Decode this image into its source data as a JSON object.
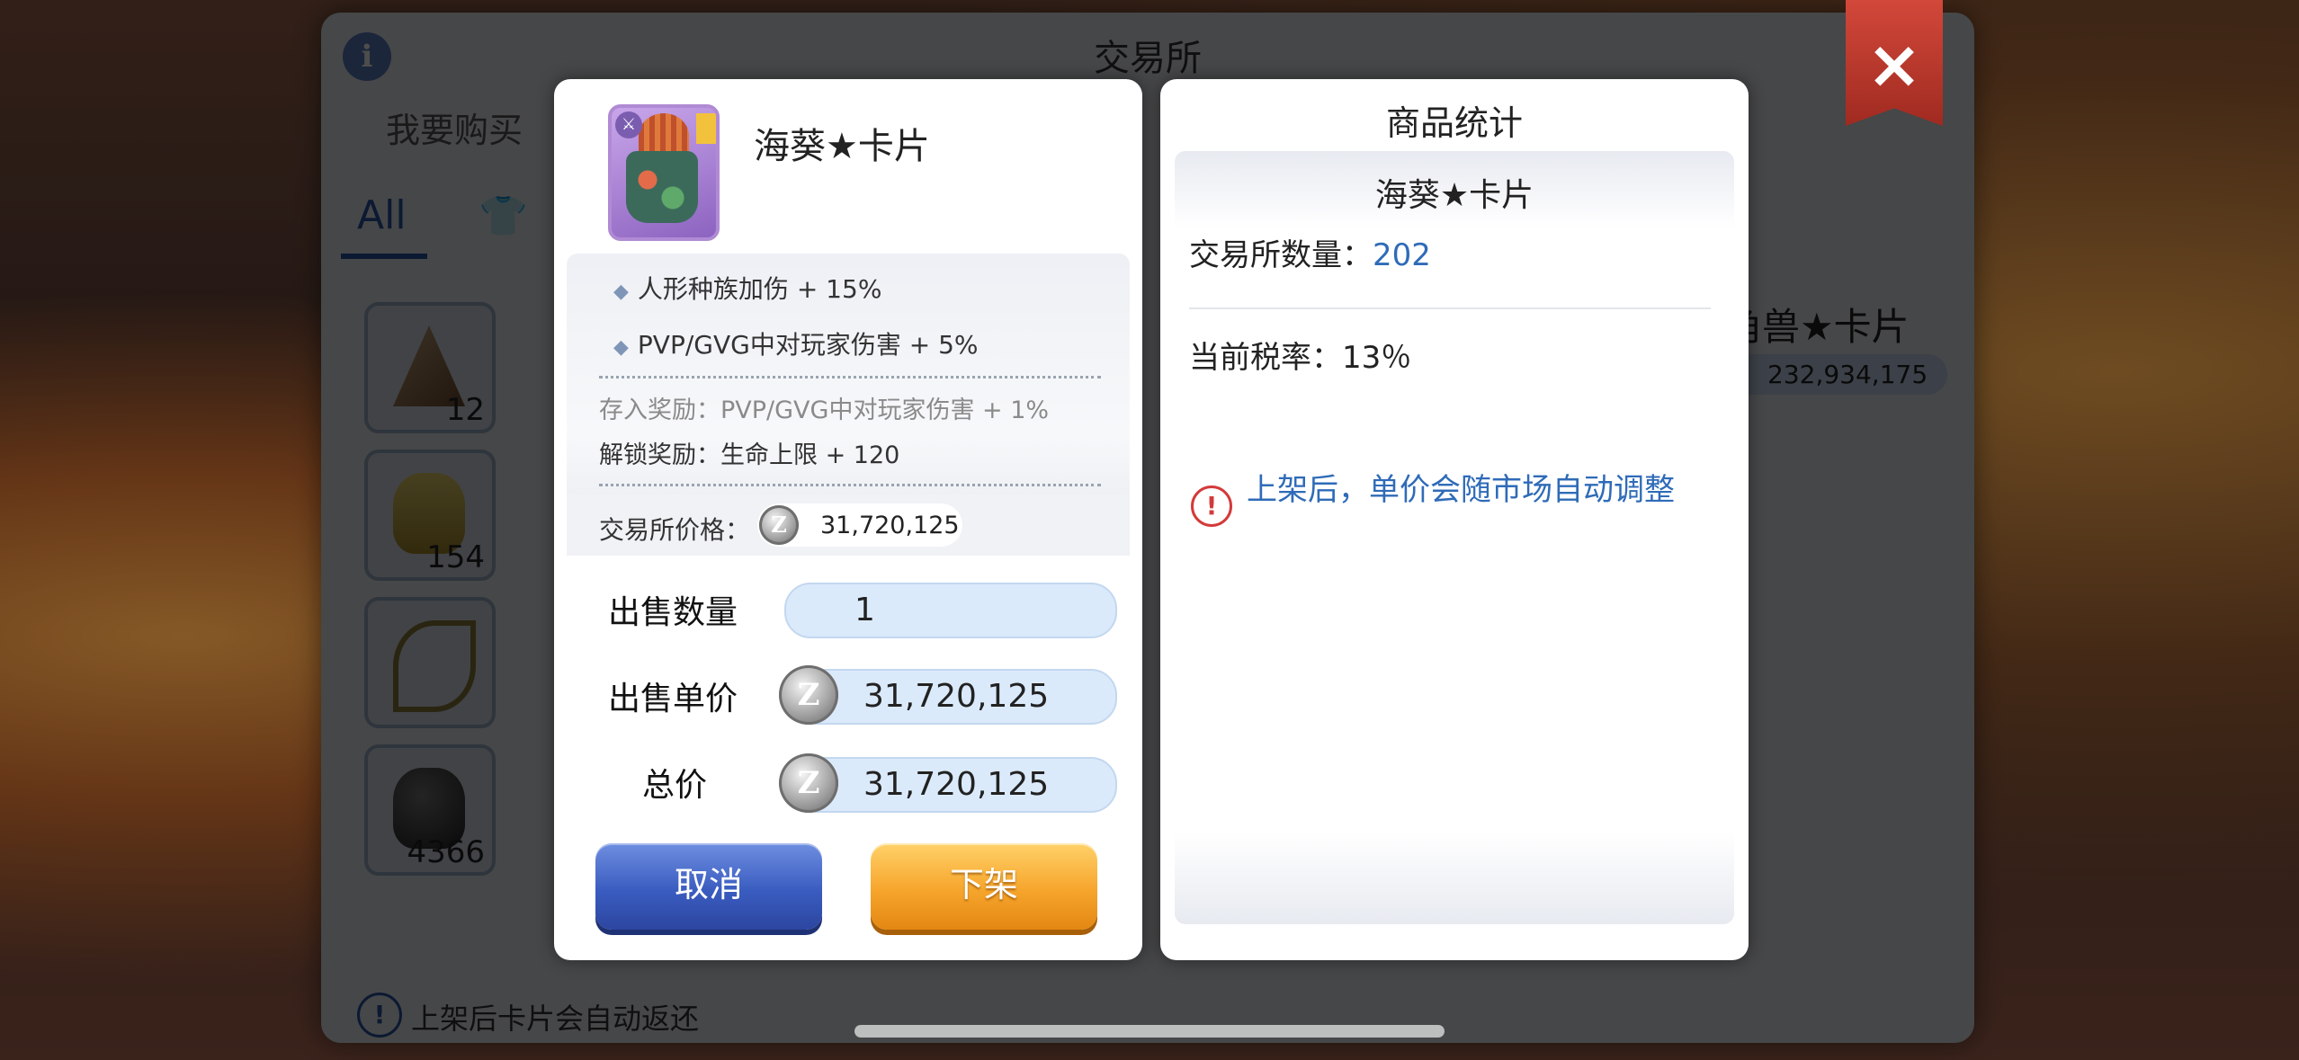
{
  "exchange": {
    "title": "交易所",
    "info_icon": "i",
    "tab_buy": "我要购买",
    "category_all": "All",
    "slot_quantities": [
      "12",
      "154",
      "",
      "4366"
    ],
    "right_item_name": "角兽★卡片",
    "right_item_price": "232,934,175",
    "bottom_notice": "上架后卡片会自动返还",
    "close_label": "×"
  },
  "item": {
    "name": "海葵★卡片",
    "attributes": [
      "人形种族加伤 + 15%",
      "PVP/GVG中对玩家伤害 + 5%"
    ],
    "store_bonus": "存入奖励：PVP/GVG中对玩家伤害 + 1%",
    "unlock_bonus": "解锁奖励：生命上限 + 120",
    "price_label": "交易所价格：",
    "price": "31,720,125"
  },
  "sell_form": {
    "quantity_label": "出售数量",
    "quantity": "1",
    "unit_price_label": "出售单价",
    "unit_price": "31,720,125",
    "total_label": "总价",
    "total": "31,720,125",
    "cancel_label": "取消",
    "delist_label": "下架"
  },
  "stats": {
    "title": "商品统计",
    "item_name": "海葵★卡片",
    "count_label": "交易所数量：",
    "count": "202",
    "tax_label": "当前税率：",
    "tax": "13％",
    "warning": "上架后，单价会随市场自动调整"
  },
  "icons": {
    "zeny_coin": "Z",
    "warning": "!",
    "diamond": "◆"
  },
  "colors": {
    "accent_blue": "#2f6bb8",
    "cancel_button": "#3a5cc0",
    "delist_button": "#f6a52c",
    "field_bg": "#dbeafb"
  }
}
